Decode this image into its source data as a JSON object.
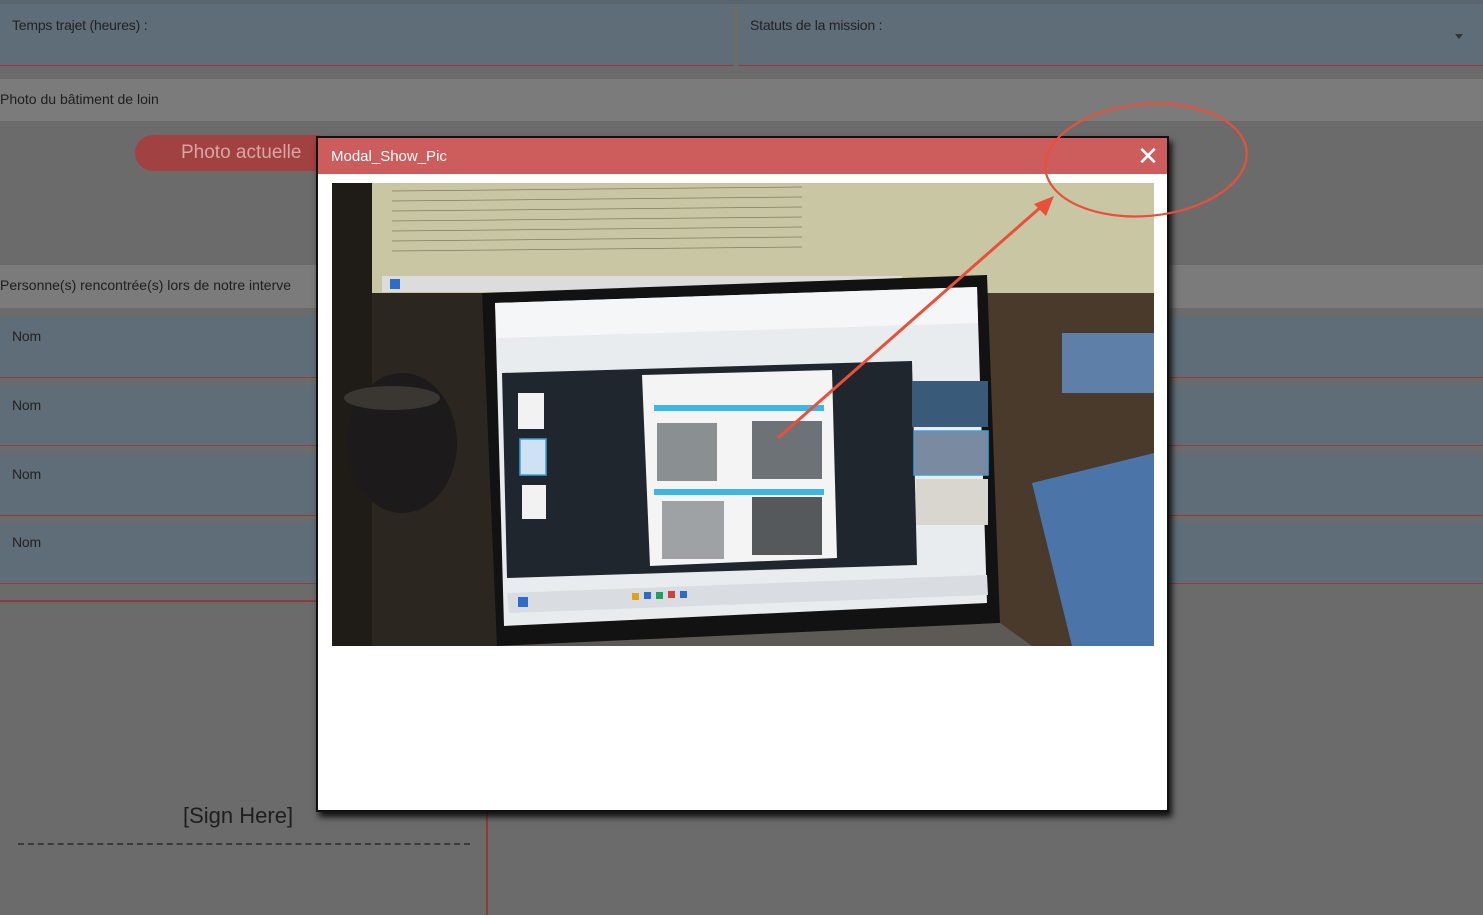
{
  "form": {
    "travel_time_label": "Temps trajet (heures) :",
    "mission_status_label": "Statuts de la mission :",
    "far_photo_section": "Photo du bâtiment de loin",
    "current_photo_button": "Photo actuelle",
    "people_section": "Personne(s) rencontrée(s) lors de notre interve",
    "people_rows": [
      {
        "label": "Nom"
      },
      {
        "label": "Nom"
      },
      {
        "label": "Nom"
      },
      {
        "label": "Nom"
      }
    ],
    "signature_placeholder": "[Sign Here]"
  },
  "modal": {
    "title": "Modal_Show_Pic",
    "close_icon": "close-icon",
    "image": "photo-of-laptop-screen"
  },
  "colors": {
    "modal_header": "#cd5c5c",
    "field_bg": "#5f6d79",
    "annotation": "#e8503a"
  }
}
